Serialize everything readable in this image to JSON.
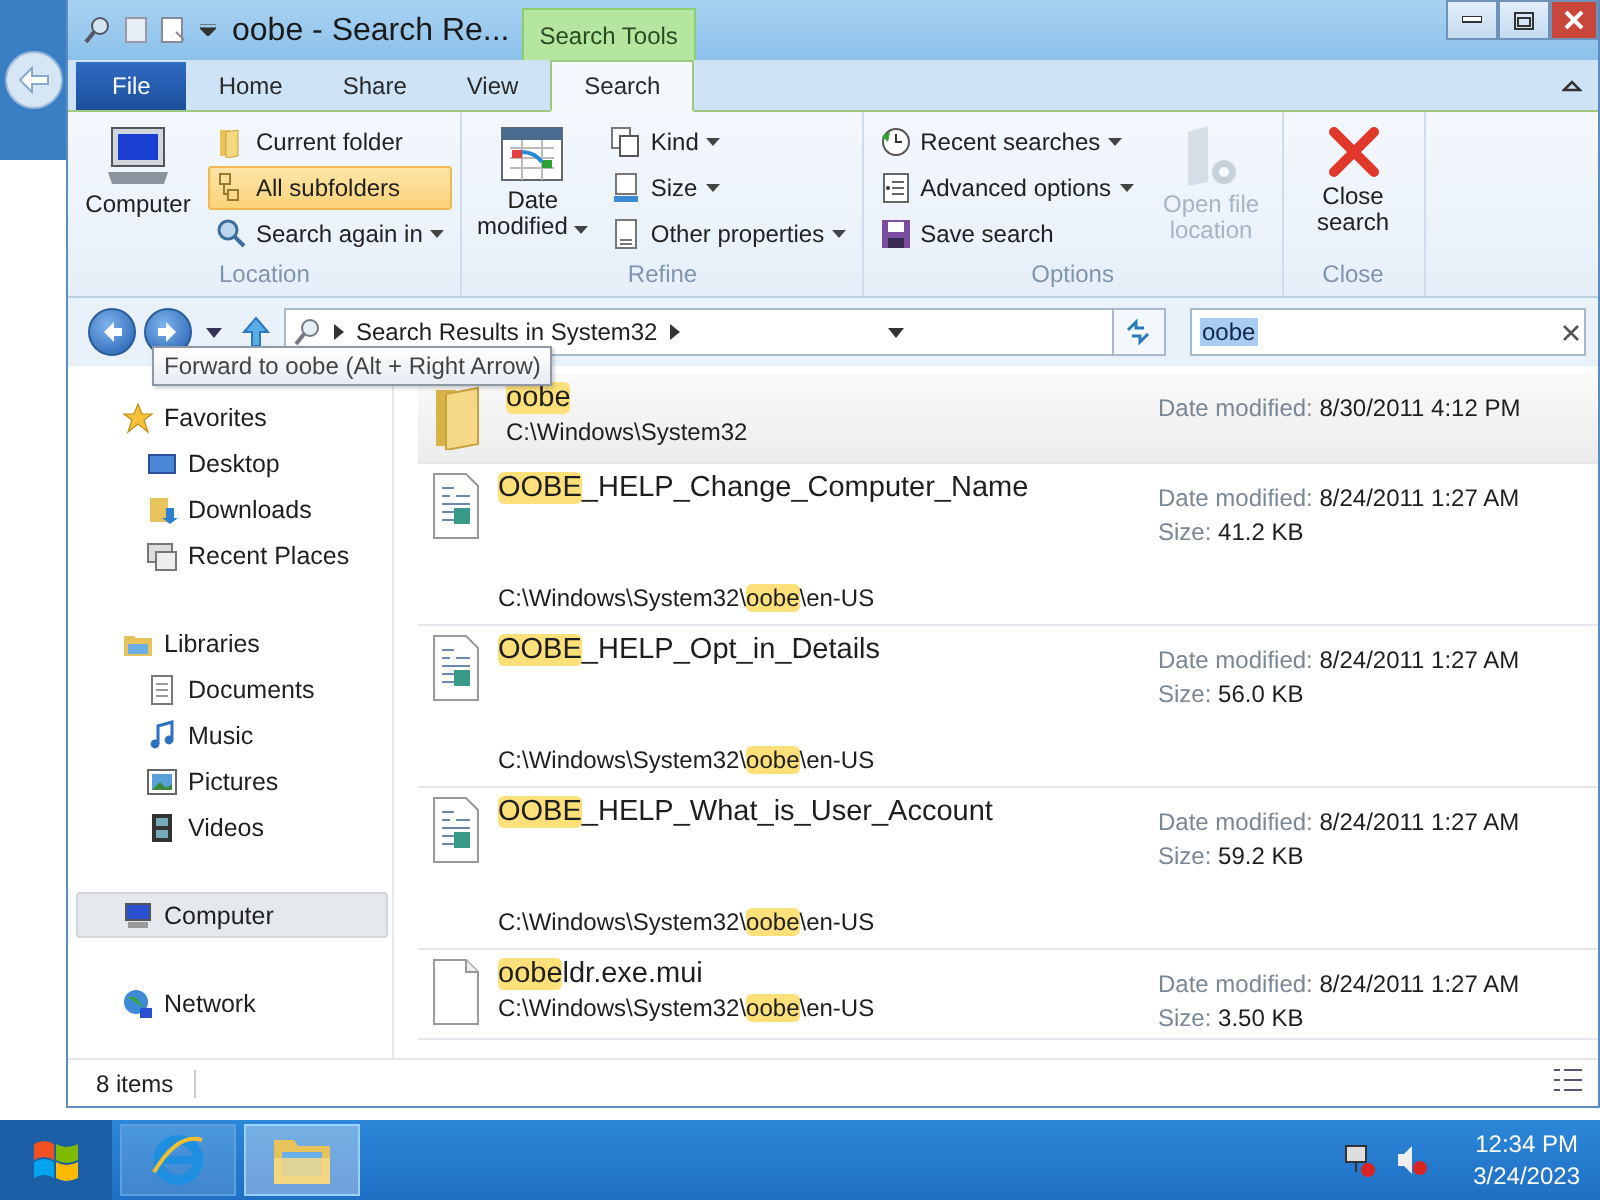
{
  "window": {
    "title": "oobe - Search Re...",
    "contextual_tab_header": "Search Tools"
  },
  "ribbon_tabs": [
    {
      "label": "File",
      "kind": "file",
      "selected": false
    },
    {
      "label": "Home",
      "kind": "tab",
      "selected": false
    },
    {
      "label": "Share",
      "kind": "tab",
      "selected": false
    },
    {
      "label": "View",
      "kind": "tab",
      "selected": false
    },
    {
      "label": "Search",
      "kind": "tab",
      "selected": true
    }
  ],
  "ribbon_groups": [
    {
      "label": "Location",
      "columns": [
        [
          {
            "label": "Computer",
            "kind": "large",
            "dropdown": false,
            "disabled": false
          }
        ],
        [
          {
            "label": "Current folder",
            "kind": "small",
            "dropdown": false,
            "disabled": false,
            "selected": false
          },
          {
            "label": "All subfolders",
            "kind": "small",
            "dropdown": false,
            "disabled": false,
            "selected": true
          },
          {
            "label": "Search again in",
            "kind": "small",
            "dropdown": true,
            "disabled": false
          }
        ]
      ]
    },
    {
      "label": "Refine",
      "columns": [
        [
          {
            "label": "Date modified",
            "kind": "large",
            "dropdown": true,
            "disabled": false
          }
        ],
        [
          {
            "label": "Kind",
            "kind": "small",
            "dropdown": true,
            "disabled": false
          },
          {
            "label": "Size",
            "kind": "small",
            "dropdown": true,
            "disabled": false
          },
          {
            "label": "Other properties",
            "kind": "small",
            "dropdown": true,
            "disabled": false
          }
        ]
      ]
    },
    {
      "label": "Options",
      "columns": [
        [
          {
            "label": "Recent searches",
            "kind": "small",
            "dropdown": true,
            "disabled": false
          },
          {
            "label": "Advanced options",
            "kind": "small",
            "dropdown": true,
            "disabled": false
          },
          {
            "label": "Save search",
            "kind": "small",
            "dropdown": false,
            "disabled": false
          }
        ],
        [
          {
            "label": "Open file location",
            "kind": "large",
            "dropdown": false,
            "disabled": true
          }
        ]
      ]
    },
    {
      "label": "Close",
      "columns": [
        [
          {
            "label": "Close search",
            "kind": "large",
            "dropdown": false,
            "disabled": false
          }
        ]
      ]
    }
  ],
  "address_bar": {
    "path": "Search Results in System32"
  },
  "search": {
    "value": "oobe"
  },
  "tooltip": "Forward to oobe (Alt + Right Arrow)",
  "navigation": [
    {
      "label": "Favorites",
      "selected": false,
      "children": [
        {
          "label": "Desktop",
          "selected": false
        },
        {
          "label": "Downloads",
          "selected": false
        },
        {
          "label": "Recent Places",
          "selected": false
        }
      ]
    },
    {
      "label": "Libraries",
      "selected": false,
      "children": [
        {
          "label": "Documents",
          "selected": false
        },
        {
          "label": "Music",
          "selected": false
        },
        {
          "label": "Pictures",
          "selected": false
        },
        {
          "label": "Videos",
          "selected": false
        }
      ]
    },
    {
      "label": "Computer",
      "selected": true
    },
    {
      "label": "Network",
      "selected": false
    }
  ],
  "results": [
    {
      "kind": "folder",
      "selected": true,
      "name": [
        {
          "text": "oobe",
          "match": true
        }
      ],
      "path": [
        {
          "text": "C:\\Windows\\System32",
          "match": false
        }
      ],
      "details": [
        {
          "label": "Date modified:",
          "value": "8/30/2011 4:12 PM"
        }
      ]
    },
    {
      "kind": "document",
      "selected": false,
      "name": [
        {
          "text": "OOBE",
          "match": true
        },
        {
          "text": "_HELP_Change_Computer_Name",
          "match": false
        }
      ],
      "path": [
        {
          "text": "C:\\Windows\\System32\\",
          "match": false
        },
        {
          "text": "oobe",
          "match": true
        },
        {
          "text": "\\en-US",
          "match": false
        }
      ],
      "details": [
        {
          "label": "Date modified:",
          "value": "8/24/2011 1:27 AM"
        },
        {
          "label": "Size:",
          "value": "41.2 KB"
        }
      ]
    },
    {
      "kind": "document",
      "selected": false,
      "name": [
        {
          "text": "OOBE",
          "match": true
        },
        {
          "text": "_HELP_Opt_in_Details",
          "match": false
        }
      ],
      "path": [
        {
          "text": "C:\\Windows\\System32\\",
          "match": false
        },
        {
          "text": "oobe",
          "match": true
        },
        {
          "text": "\\en-US",
          "match": false
        }
      ],
      "details": [
        {
          "label": "Date modified:",
          "value": "8/24/2011 1:27 AM"
        },
        {
          "label": "Size:",
          "value": "56.0 KB"
        }
      ]
    },
    {
      "kind": "document",
      "selected": false,
      "name": [
        {
          "text": "OOBE",
          "match": true
        },
        {
          "text": "_HELP_What_is_User_Account",
          "match": false
        }
      ],
      "path": [
        {
          "text": "C:\\Windows\\System32\\",
          "match": false
        },
        {
          "text": "oobe",
          "match": true
        },
        {
          "text": "\\en-US",
          "match": false
        }
      ],
      "details": [
        {
          "label": "Date modified:",
          "value": "8/24/2011 1:27 AM"
        },
        {
          "label": "Size:",
          "value": "59.2 KB"
        }
      ]
    },
    {
      "kind": "file",
      "selected": false,
      "name": [
        {
          "text": "oobe",
          "match": true
        },
        {
          "text": "ldr.exe.mui",
          "match": false
        }
      ],
      "path": [
        {
          "text": "C:\\Windows\\System32\\",
          "match": false
        },
        {
          "text": "oobe",
          "match": true
        },
        {
          "text": "\\en-US",
          "match": false
        }
      ],
      "details": [
        {
          "label": "Date modified:",
          "value": "8/24/2011 1:27 AM"
        },
        {
          "label": "Size:",
          "value": "3.50 KB"
        }
      ]
    }
  ],
  "status_bar": {
    "item_count": "8 items"
  },
  "taskbar": {
    "pinned": [
      {
        "kind": "browser",
        "active": false
      },
      {
        "kind": "explorer",
        "active": true
      }
    ],
    "time": "12:34 PM",
    "date": "3/24/2023"
  }
}
